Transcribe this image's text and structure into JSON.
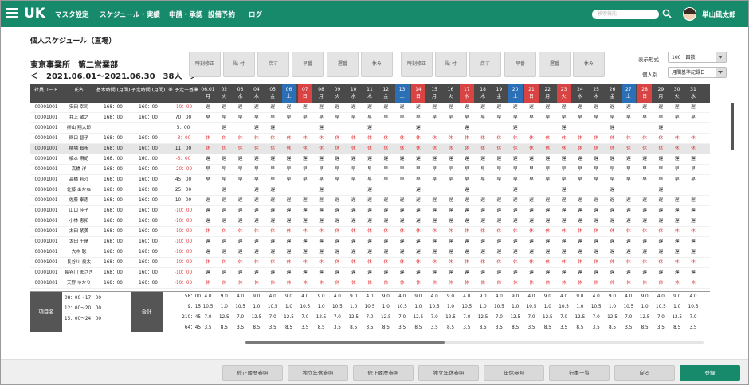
{
  "nav": {
    "logo": "UK",
    "items": [
      "マスタ設定",
      "スケジュール・実績",
      "申請・承認",
      "設備予約",
      "ログ"
    ],
    "search_placeholder": "検索機能",
    "username": "単山凪太郎"
  },
  "page": {
    "title": "個人スケジュール（直場）",
    "office": "東京事業所　第二営業部",
    "period": "＜　2021.06.01〜2021.06.30　38人　＞"
  },
  "toolbar": [
    "時刻修正",
    "貼 付",
    "戻す",
    "早番",
    "遅番",
    "休み",
    "時刻修正",
    "貼 付",
    "戻す",
    "早番",
    "遅番",
    "休み"
  ],
  "display": {
    "format_label": "表示形式",
    "format_value": "100　四数",
    "person_label": "個人別",
    "person_value": "月間基準記録日"
  },
  "columns": {
    "code": "社員コード",
    "name": "氏名",
    "base": "基本時間 (月間)",
    "plan": "予定時間 (月間)",
    "diff": "差 予定ー基準"
  },
  "days": [
    {
      "d": "06.01",
      "w": "月",
      "c": "n"
    },
    {
      "d": "02",
      "w": "火",
      "c": "n"
    },
    {
      "d": "03",
      "w": "水",
      "c": "n"
    },
    {
      "d": "04",
      "w": "木",
      "c": "n"
    },
    {
      "d": "05",
      "w": "金",
      "c": "n"
    },
    {
      "d": "06",
      "w": "土",
      "c": "b"
    },
    {
      "d": "07",
      "w": "日",
      "c": "r"
    },
    {
      "d": "08",
      "w": "月",
      "c": "n"
    },
    {
      "d": "09",
      "w": "火",
      "c": "n"
    },
    {
      "d": "10",
      "w": "水",
      "c": "n"
    },
    {
      "d": "11",
      "w": "木",
      "c": "n"
    },
    {
      "d": "12",
      "w": "金",
      "c": "n"
    },
    {
      "d": "13",
      "w": "土",
      "c": "b"
    },
    {
      "d": "14",
      "w": "日",
      "c": "r"
    },
    {
      "d": "15",
      "w": "月",
      "c": "n"
    },
    {
      "d": "16",
      "w": "火",
      "c": "n"
    },
    {
      "d": "17",
      "w": "水",
      "c": "r"
    },
    {
      "d": "18",
      "w": "木",
      "c": "n"
    },
    {
      "d": "19",
      "w": "金",
      "c": "n"
    },
    {
      "d": "20",
      "w": "土",
      "c": "b"
    },
    {
      "d": "21",
      "w": "日",
      "c": "r"
    },
    {
      "d": "22",
      "w": "月",
      "c": "n"
    },
    {
      "d": "23",
      "w": "火",
      "c": "r"
    },
    {
      "d": "24",
      "w": "水",
      "c": "n"
    },
    {
      "d": "25",
      "w": "木",
      "c": "n"
    },
    {
      "d": "26",
      "w": "金",
      "c": "n"
    },
    {
      "d": "27",
      "w": "土",
      "c": "b"
    },
    {
      "d": "28",
      "w": "日",
      "c": "r"
    },
    {
      "d": "29",
      "w": "月",
      "c": "n"
    },
    {
      "d": "30",
      "w": "火",
      "c": "n"
    },
    {
      "d": "31",
      "w": "水",
      "c": "n"
    }
  ],
  "rows": [
    {
      "code": "00001001",
      "name": "安田 幸司",
      "base": "168：00",
      "plan": "160：00",
      "diff": "-10：00",
      "neg": true,
      "p": "A"
    },
    {
      "code": "00001001",
      "name": "井上 敏之",
      "base": "168：00",
      "plan": "160：00",
      "diff": "70：00",
      "neg": false,
      "p": "B"
    },
    {
      "code": "00001001",
      "name": "柳山 翔太郎",
      "base": "",
      "plan": "",
      "diff": "5：00",
      "neg": false,
      "p": "S"
    },
    {
      "code": "00001001",
      "name": "関口 智子",
      "base": "168：00",
      "plan": "160：00",
      "diff": "-3：00",
      "neg": true,
      "p": "R"
    },
    {
      "code": "00001001",
      "name": "柳場 真歩",
      "base": "168：00",
      "plan": "160：00",
      "diff": "11：00",
      "neg": false,
      "p": "R",
      "sel": true
    },
    {
      "code": "00001001",
      "name": "橋本 麻紀",
      "base": "168：00",
      "plan": "160：00",
      "diff": "-5：00",
      "neg": true,
      "p": "A"
    },
    {
      "code": "00001001",
      "name": "高橋 洋",
      "base": "168：00",
      "plan": "160：00",
      "diff": "-20：00",
      "neg": true,
      "p": "B"
    },
    {
      "code": "00001001",
      "name": "高橋 莉沙",
      "base": "168：00",
      "plan": "160：00",
      "diff": "45：00",
      "neg": false,
      "p": "B"
    },
    {
      "code": "00001001",
      "name": "佐藤 あかね",
      "base": "168：00",
      "plan": "160：00",
      "diff": "25：00",
      "neg": false,
      "p": "S"
    },
    {
      "code": "00001001",
      "name": "佐藤 泰恵",
      "base": "168：00",
      "plan": "160：00",
      "diff": "10：00",
      "neg": false,
      "p": "A"
    },
    {
      "code": "00001001",
      "name": "山口 佳子",
      "base": "168：00",
      "plan": "160：00",
      "diff": "-10：00",
      "neg": true,
      "p": "A"
    },
    {
      "code": "00001001",
      "name": "小林 恵拓",
      "base": "168：00",
      "plan": "160：00",
      "diff": "-10：00",
      "neg": true,
      "p": "A"
    },
    {
      "code": "00001001",
      "name": "太田 紫美",
      "base": "168：00",
      "plan": "160：00",
      "diff": "-10：00",
      "neg": true,
      "p": "R"
    },
    {
      "code": "00001001",
      "name": "太田 千晴",
      "base": "168：00",
      "plan": "160：00",
      "diff": "-10：00",
      "neg": true,
      "p": "A"
    },
    {
      "code": "00001001",
      "name": "大木 聡",
      "base": "168：00",
      "plan": "160：00",
      "diff": "-10：00",
      "neg": true,
      "p": "A"
    },
    {
      "code": "00001001",
      "name": "長谷川 良太",
      "base": "168：00",
      "plan": "160：00",
      "diff": "-10：00",
      "neg": true,
      "p": "R"
    },
    {
      "code": "00001001",
      "name": "長谷川 まさき",
      "base": "168：00",
      "plan": "160：00",
      "diff": "-10：00",
      "neg": true,
      "p": "A"
    },
    {
      "code": "00001001",
      "name": "天野 ゆかり",
      "base": "168：00",
      "plan": "160：00",
      "diff": "-10：00",
      "neg": true,
      "p": "R"
    }
  ],
  "patterns": {
    "A": [
      "遅",
      "遅",
      "遅",
      "遅",
      "遅",
      "遅",
      "遅",
      "遅",
      "遅",
      "遅",
      "遅",
      "遅",
      "遅",
      "遅",
      "遅",
      "遅",
      "遅",
      "遅",
      "遅",
      "遅",
      "遅",
      "遅",
      "遅",
      "遅",
      "遅",
      "遅",
      "遅",
      "遅",
      "遅",
      "遅",
      "遅"
    ],
    "B": [
      "早",
      "早",
      "早",
      "早",
      "早",
      "早",
      "早",
      "早",
      "早",
      "早",
      "早",
      "早",
      "早",
      "早",
      "早",
      "早",
      "早",
      "早",
      "早",
      "早",
      "早",
      "早",
      "早",
      "早",
      "早",
      "早",
      "早",
      "早",
      "早",
      "早",
      "早"
    ],
    "S": [
      "",
      "遅",
      "",
      "遅",
      "遅",
      "",
      "",
      "遅",
      "",
      "",
      "遅",
      "",
      "",
      "遅",
      "",
      "",
      "遅",
      "",
      "",
      "遅",
      "",
      "",
      "遅",
      "",
      "",
      "遅",
      "",
      "",
      "遅",
      "",
      ""
    ],
    "R": [
      "休",
      "休",
      "休",
      "休",
      "休",
      "休",
      "休",
      "休",
      "休",
      "休",
      "休",
      "休",
      "休",
      "休",
      "休",
      "休",
      "休",
      "休",
      "休",
      "休",
      "休",
      "休",
      "休",
      "休",
      "休",
      "休",
      "休",
      "休",
      "休",
      "休",
      "休"
    ]
  },
  "summary": {
    "item_label": "項目名",
    "total_label": "合計",
    "slots": [
      "08：00〜17：00",
      "12：00〜20：00",
      "15：00〜24：00"
    ],
    "totals": [
      "58：00",
      "9：15",
      "210：45",
      "64：45"
    ],
    "values": [
      [
        "4.0",
        "9.0",
        "4.0",
        "9.0",
        "4.0",
        "9.0",
        "4.0",
        "9.0",
        "4.0",
        "9.0",
        "4.0",
        "9.0",
        "4.0",
        "9.0",
        "4.0",
        "9.0",
        "4.0",
        "9.0",
        "4.0",
        "9.0",
        "4.0",
        "9.0",
        "4.0",
        "9.0",
        "4.0",
        "9.0",
        "4.0",
        "9.0",
        "4.0",
        "9.0",
        "4.0"
      ],
      [
        "10.5",
        "1.0",
        "10.5",
        "1.0",
        "10.5",
        "1.0",
        "10.5",
        "1.0",
        "10.5",
        "1.0",
        "10.5",
        "1.0",
        "10.5",
        "1.0",
        "10.5",
        "1.0",
        "10.5",
        "1.0",
        "10.5",
        "1.0",
        "10.5",
        "1.0",
        "10.5",
        "1.0",
        "10.5",
        "1.0",
        "10.5",
        "1.0",
        "10.5",
        "1.0",
        "10.5"
      ],
      [
        "7.0",
        "12.5",
        "7.0",
        "12.5",
        "7.0",
        "12.5",
        "7.0",
        "12.5",
        "7.0",
        "12.5",
        "7.0",
        "12.5",
        "7.0",
        "12.5",
        "7.0",
        "12.5",
        "7.0",
        "12.5",
        "7.0",
        "12.5",
        "7.0",
        "12.5",
        "7.0",
        "12.5",
        "7.0",
        "12.5",
        "7.0",
        "12.5",
        "7.0",
        "12.5",
        "7.0"
      ],
      [
        "3.5",
        "8.5",
        "3.5",
        "8.5",
        "3.5",
        "8.5",
        "3.5",
        "8.5",
        "3.5",
        "8.5",
        "3.5",
        "8.5",
        "3.5",
        "8.5",
        "3.5",
        "8.5",
        "3.5",
        "8.5",
        "3.5",
        "8.5",
        "3.5",
        "8.5",
        "3.5",
        "8.5",
        "3.5",
        "8.5",
        "3.5",
        "8.5",
        "3.5",
        "8.5",
        "3.5"
      ]
    ]
  },
  "bottom_buttons": [
    "修正履歴参照",
    "独立年休参照",
    "修正履歴参照",
    "独立年休参照",
    "年休参照",
    "行事一覧",
    "戻る",
    "登録"
  ],
  "colors": {
    "primary": "#178a6c",
    "sat": "#2b6fb7",
    "sun": "#d84343",
    "red_text": "#e03434"
  }
}
